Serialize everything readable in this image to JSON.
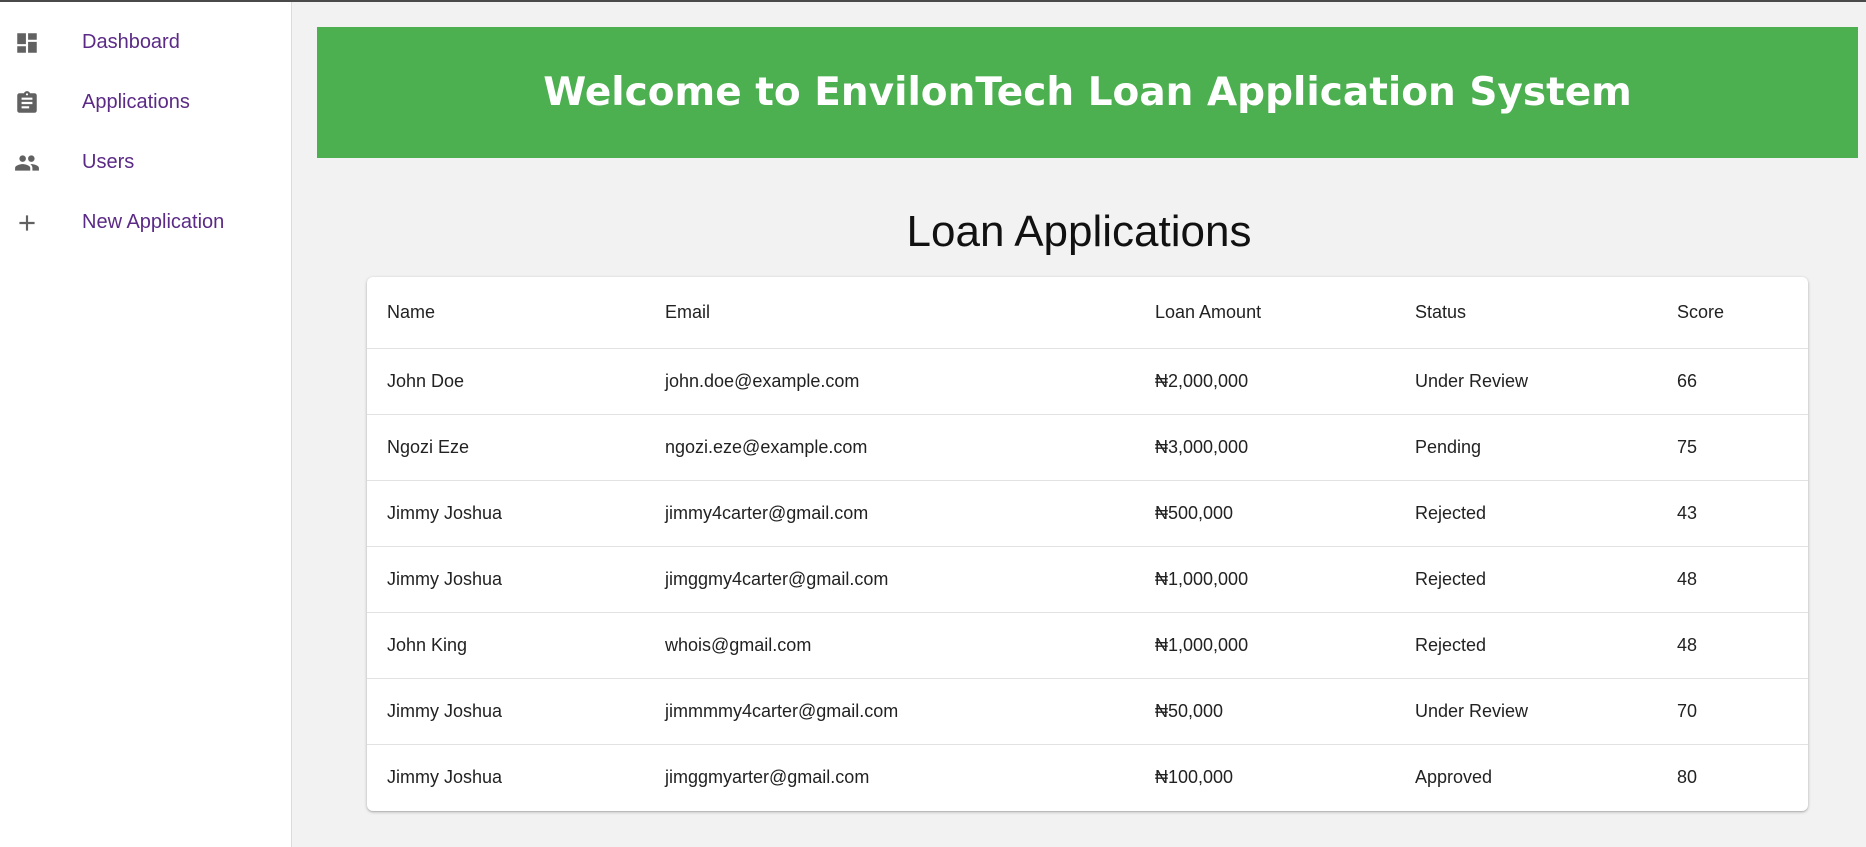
{
  "sidebar": {
    "items": [
      {
        "label": "Dashboard",
        "icon": "dashboard-icon"
      },
      {
        "label": "Applications",
        "icon": "clipboard-icon"
      },
      {
        "label": "Users",
        "icon": "people-icon"
      },
      {
        "label": "New Application",
        "icon": "plus-icon"
      }
    ]
  },
  "banner": {
    "title": "Welcome to EnvilonTech Loan Application System",
    "color": "#4caf50"
  },
  "page_title": "Loan Applications",
  "table": {
    "columns": [
      "Name",
      "Email",
      "Loan Amount",
      "Status",
      "Score"
    ],
    "rows": [
      [
        "John Doe",
        "john.doe@example.com",
        "₦2,000,000",
        "Under Review",
        "66"
      ],
      [
        "Ngozi Eze",
        "ngozi.eze@example.com",
        "₦3,000,000",
        "Pending",
        "75"
      ],
      [
        "Jimmy Joshua",
        "jimmy4carter@gmail.com",
        "₦500,000",
        "Rejected",
        "43"
      ],
      [
        "Jimmy Joshua",
        "jimggmy4carter@gmail.com",
        "₦1,000,000",
        "Rejected",
        "48"
      ],
      [
        "John King",
        "whois@gmail.com",
        "₦1,000,000",
        "Rejected",
        "48"
      ],
      [
        "Jimmy Joshua",
        "jimmmmy4carter@gmail.com",
        "₦50,000",
        "Under Review",
        "70"
      ],
      [
        "Jimmy Joshua",
        "jimggmyarter@gmail.com",
        "₦100,000",
        "Approved",
        "80"
      ]
    ]
  },
  "colors": {
    "nav_link": "#5b2a86",
    "icon": "#616161",
    "background": "#f2f2f2"
  }
}
